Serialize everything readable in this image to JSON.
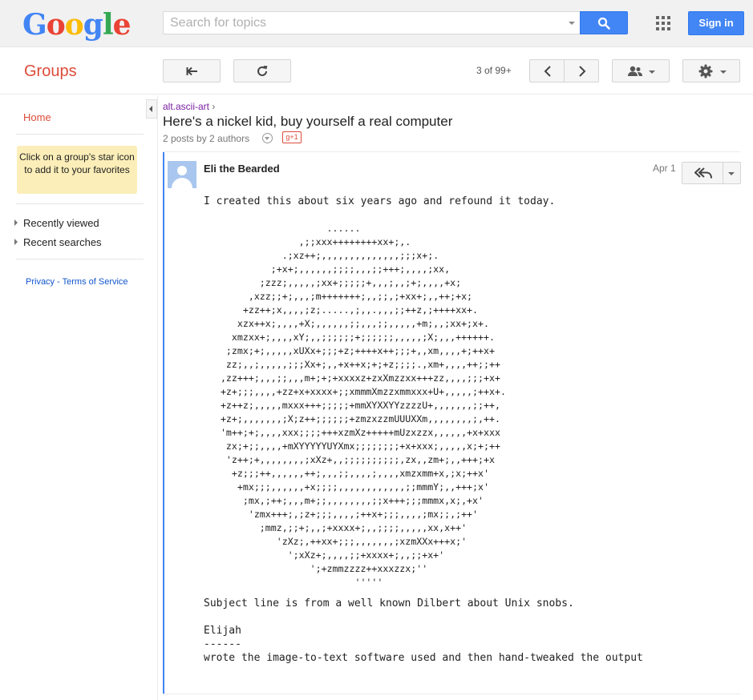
{
  "topbar": {
    "logo_text": "Google",
    "search_placeholder": "Search for topics",
    "signin_label": "Sign in"
  },
  "subbar": {
    "title": "Groups",
    "page_count": "3 of 99+"
  },
  "icons": {
    "back": "back-arrow-icon",
    "refresh": "refresh-icon",
    "prev": "chevron-left-icon",
    "next": "chevron-right-icon",
    "people": "people-icon",
    "gear": "gear-icon",
    "search": "search-icon",
    "apps": "apps-grid-icon",
    "reply": "reply-all-icon"
  },
  "leftnav": {
    "home": "Home",
    "favorites_hint": "Click on a group's star icon to add it to your favorites",
    "recently_viewed": "Recently viewed",
    "recent_searches": "Recent searches",
    "privacy": "Privacy",
    "link_sep": " - ",
    "terms": "Terms of Service"
  },
  "thread": {
    "group": "alt.ascii-art",
    "breadcrumb_sep": "›",
    "title": "Here's a nickel kid, buy yourself a real computer",
    "meta": "2 posts by 2 authors",
    "gplus": "g+1"
  },
  "post": {
    "author": "Eli the Bearded",
    "date": "Apr 1",
    "intro": "I created this about six years ago and refound it today.",
    "ascii_art": "                      ......\n                 ,;;xxx++++++++xx+;,.\n              .;xz++;,,,,,,,,,,,,,,;;;x+;.\n            ;+x+;,,,,,,;;;;,,,;;+++;,,,,;xx,\n          ;zzz;,,,,,;xx+;;;;;+,,,;,,;+;,,,,+x;\n        ,xzz;;+;,,,;m+++++++;,,;;,;+xx+;,,++;+x;\n       +zz++;x,,,,;z;.....,;,,.,,,;;++z,;++++xx+.\n      xzx++x;,,,,+X;,,,,,,;;,,,;;,,,,,+m;,,;xx+;x+.\n     xmzxx+;,,,,xY;,,;;;;;;+;;;;;;,,,,,;X;,,,++++++.\n    ;zmx;+;,,,,,xUXx+;;;+z;++++x++;;;+,,xm,,,,+;++x+\n    zz;,,;,,,,,;;;Xx+;,,+x++x;+;+z;;;;.,xm+,,,,++;;++\n   ,zz+++;,,,;;,,,m+;+;+xxxxz+zxXmzzxx+++zz,,,,;;;+x+\n   +z+;;;,,,,+zz+x+xxxx+;;xmmmXmzzxmmxxx+U+,,,,,;++x+.\n   +z++z;,,,,,mxxx+++;;;;;+mmXYXXYYzzzzU+,,,,,,,;;++,\n   +z+;,,,,,,,;X;z++;;;;;;+zmzxzzmUUUXXm,,,,,,,,;,++.\n   'm++;+;,,,,xxx;;;;+++xzmXz+++++mUzxzzx,,,,,,+x+xxx\n    zx;+;;,,,,+mXYYYYYUYXmx;;;;;;;;+x+xxx;,,,,,x;+;++\n    'z++;+,,,,,,,,;xXz+,,;;;;;;;;;;,zx,,zm+;,,+++;+x\n     +z;;;++,,,,,,++;,,,;;,,,,;,,,,xmzxmm+x,;x;++x'\n      +mx;;;,,,,,,+x;;;;,,,,,,,,,,,,;;mmmY;,,+++;x'\n       ;mx,;++;,,,m+;;,,,,,,,,;;x+++;;;mmmx,x;,+x'\n        'zmx+++;,;z+;;;,,,,;++x+;;;,,,,;mx;;,;++'\n          ;mmz,;;+;,,;+xxxx+;,,;;;;,,,,,xx,x++'\n             'zXz;,++xx+;;;,,,,,,,;xzmXXx+++x;'\n               ';xXz+;,,,,;;+xxxx+;,,;;+x+'\n                   ';+zmmzzzz++xxxzzx;''\n                           '''''",
    "subject_note": "Subject line is from a well known Dilbert about Unix snobs.",
    "signature_name": "Elijah",
    "sig_dashes": "------",
    "signature_note": "wrote the image-to-text software used and then hand-tweaked the output"
  }
}
